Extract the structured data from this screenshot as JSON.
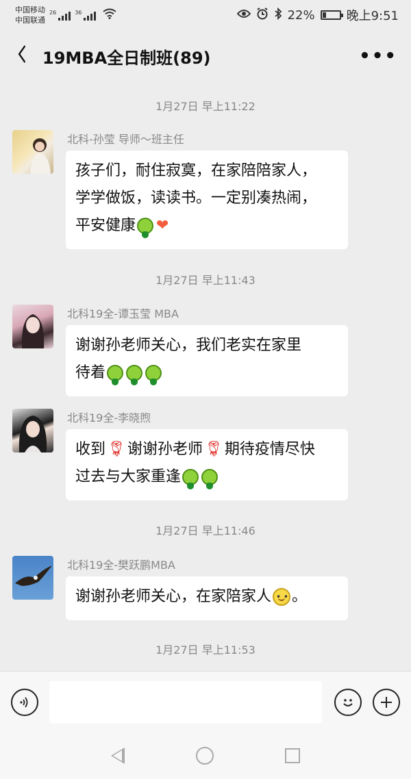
{
  "status": {
    "carrier1": "中国移动",
    "carrier2": "中国联通",
    "net1": "26",
    "net2": "36",
    "battery": "22%",
    "battery_level": 0.22,
    "time": "晚上9:51"
  },
  "header": {
    "title": "19MBA全日制班(89)",
    "more": "•••"
  },
  "messages": [
    {
      "time": "1月27日 早上11:22",
      "sender": "北科-孙莹 导师～班主任",
      "line1": "孩子们，耐住寂寞，在家陪陪家人，",
      "line2": "学学做饭，读读书。一定别凑热闹，",
      "line3": "平安健康"
    },
    {
      "time": "1月27日 早上11:43",
      "sender": "北科19全-谭玉莹 MBA",
      "line1": "谢谢孙老师关心，我们老实在家里",
      "line2": "待着"
    },
    {
      "sender": "北科19全-李晓煦",
      "line1a": "收到",
      "line1b": "谢谢孙老师",
      "line1c": "期待疫情尽快",
      "line2": "过去与大家重逢"
    },
    {
      "time": "1月27日 早上11:46",
      "sender": "北科19全-樊跃鹏MBA",
      "line1a": "谢谢孙老师关心，在家陪家人",
      "line1b": "。"
    }
  ],
  "last_time": "1月27日 早上11:53",
  "input": {
    "placeholder": "",
    "voice_icon": "voice-icon",
    "emoji_icon": "emoji-icon",
    "plus_icon": "plus-icon"
  },
  "colors": {
    "background": "#ededed",
    "bubble": "#ffffff",
    "meta_text": "#888888"
  }
}
